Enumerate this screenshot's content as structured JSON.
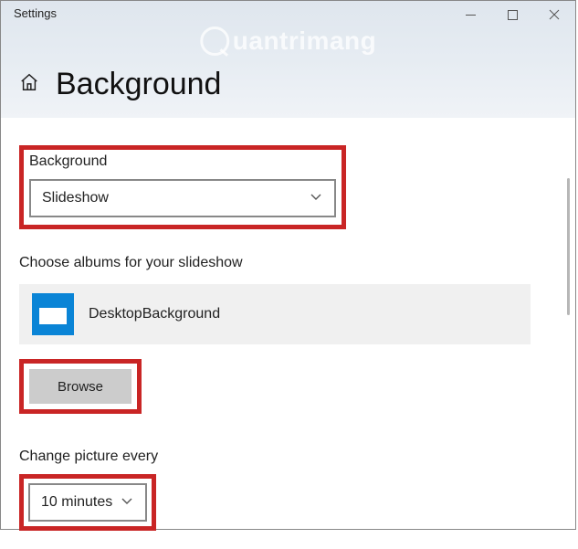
{
  "window": {
    "title": "Settings"
  },
  "page": {
    "heading": "Background"
  },
  "watermark": "uantrimang",
  "background_section": {
    "label": "Background",
    "selected": "Slideshow"
  },
  "albums": {
    "label": "Choose albums for your slideshow",
    "folder_name": "DesktopBackground",
    "browse_label": "Browse"
  },
  "interval": {
    "label": "Change picture every",
    "selected": "10 minutes"
  }
}
